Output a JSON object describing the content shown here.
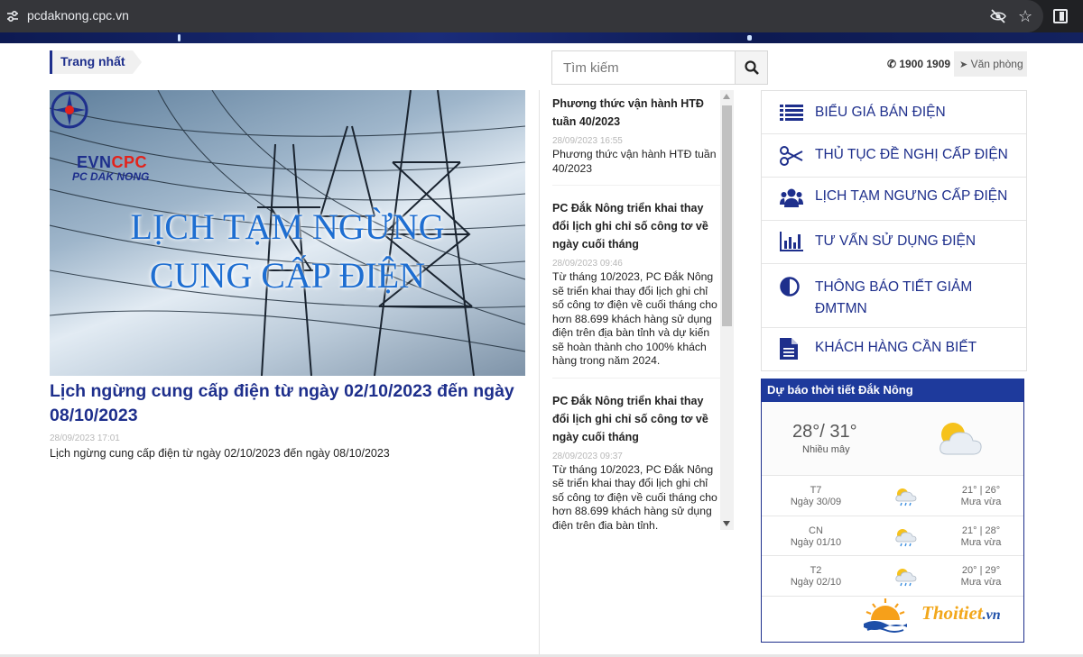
{
  "browser": {
    "url": "pcdaknong.cpc.vn",
    "icons": [
      "tune-icon",
      "eye-off-icon",
      "star-icon",
      "side-panel-icon"
    ]
  },
  "breadcrumb": {
    "label": "Trang nhất"
  },
  "featured": {
    "image": {
      "brand": "EVN",
      "brand_accent": "CPC",
      "brand_sub": "PC DAK NONG",
      "banner_line1": "LỊCH TẠM NGỪNG",
      "banner_line2": "CUNG CẤP ĐIỆN"
    },
    "title": "Lịch ngừng cung cấp điện từ ngày 02/10/2023 đến ngày 08/10/2023",
    "date": "28/09/2023 17:01",
    "summary": "Lịch ngừng cung cấp điện từ ngày 02/10/2023 đến ngày 08/10/2023"
  },
  "news": [
    {
      "title": "Phương thức vận hành HTĐ tuần 40/2023",
      "date": "28/09/2023 16:55",
      "desc": "Phương thức vận hành HTĐ tuần 40/2023"
    },
    {
      "title": "PC Đắk Nông triển khai thay đổi lịch ghi chỉ số công tơ về ngày cuối tháng",
      "date": "28/09/2023 09:46",
      "desc": "Từ tháng 10/2023, PC Đắk Nông sẽ triển khai thay đổi lịch ghi chỉ số công tơ điện về cuối tháng cho hơn 88.699 khách hàng sử dụng điện trên địa bàn tỉnh và dự kiến sẽ hoàn thành cho 100% khách hàng trong năm 2024."
    },
    {
      "title": "PC Đắk Nông triển khai thay đổi lịch ghi chỉ số công tơ về ngày cuối tháng",
      "date": "28/09/2023 09:37",
      "desc": "Từ tháng 10/2023, PC Đắk Nông sẽ triển khai thay đổi lịch ghi chỉ số công tơ điện về cuối tháng cho hơn 88.699 khách hàng sử dụng điện trên địa bàn tỉnh."
    }
  ],
  "search": {
    "placeholder": "Tìm kiếm",
    "value": ""
  },
  "contact": {
    "hotline": "1900 1909",
    "office": "Văn phòng"
  },
  "menu": [
    {
      "label": "BIỂU GIÁ BÁN ĐIỆN",
      "icon": "list-icon"
    },
    {
      "label": "THỦ TỤC ĐỀ NGHỊ CẤP ĐIỆN",
      "icon": "scissors-icon"
    },
    {
      "label": "LỊCH TẠM NGƯNG CẤP ĐIỆN",
      "icon": "users-icon"
    },
    {
      "label": "TƯ VẤN SỬ DỤNG ĐIỆN",
      "icon": "bar-chart-icon"
    },
    {
      "label": "THÔNG BÁO TIẾT GIẢM ĐMTMN",
      "icon": "contrast-icon"
    },
    {
      "label": "KHÁCH HÀNG CẦN BIẾT",
      "icon": "document-icon"
    }
  ],
  "weather": {
    "title": "Dự báo thời tiết Đắk Nông",
    "current": {
      "temp": "28°/ 31°",
      "condition": "Nhiều mây",
      "icon": "cloudy-sun-icon"
    },
    "forecast": [
      {
        "day": "T7",
        "date": "Ngày 30/09",
        "range": "21° | 26°",
        "condition": "Mưa vừa",
        "icon": "rain-icon"
      },
      {
        "day": "CN",
        "date": "Ngày 01/10",
        "range": "21° | 28°",
        "condition": "Mưa vừa",
        "icon": "rain-icon"
      },
      {
        "day": "T2",
        "date": "Ngày 02/10",
        "range": "20° | 29°",
        "condition": "Mưa vừa",
        "icon": "rain-icon"
      }
    ],
    "brand": "Thoitiet",
    "brand_tld": ".vn"
  },
  "colors": {
    "primary": "#1e2f8c",
    "accent_red": "#e3221b",
    "banner_blue": "#1e6ed1",
    "weather_head": "#1e3a9c"
  }
}
